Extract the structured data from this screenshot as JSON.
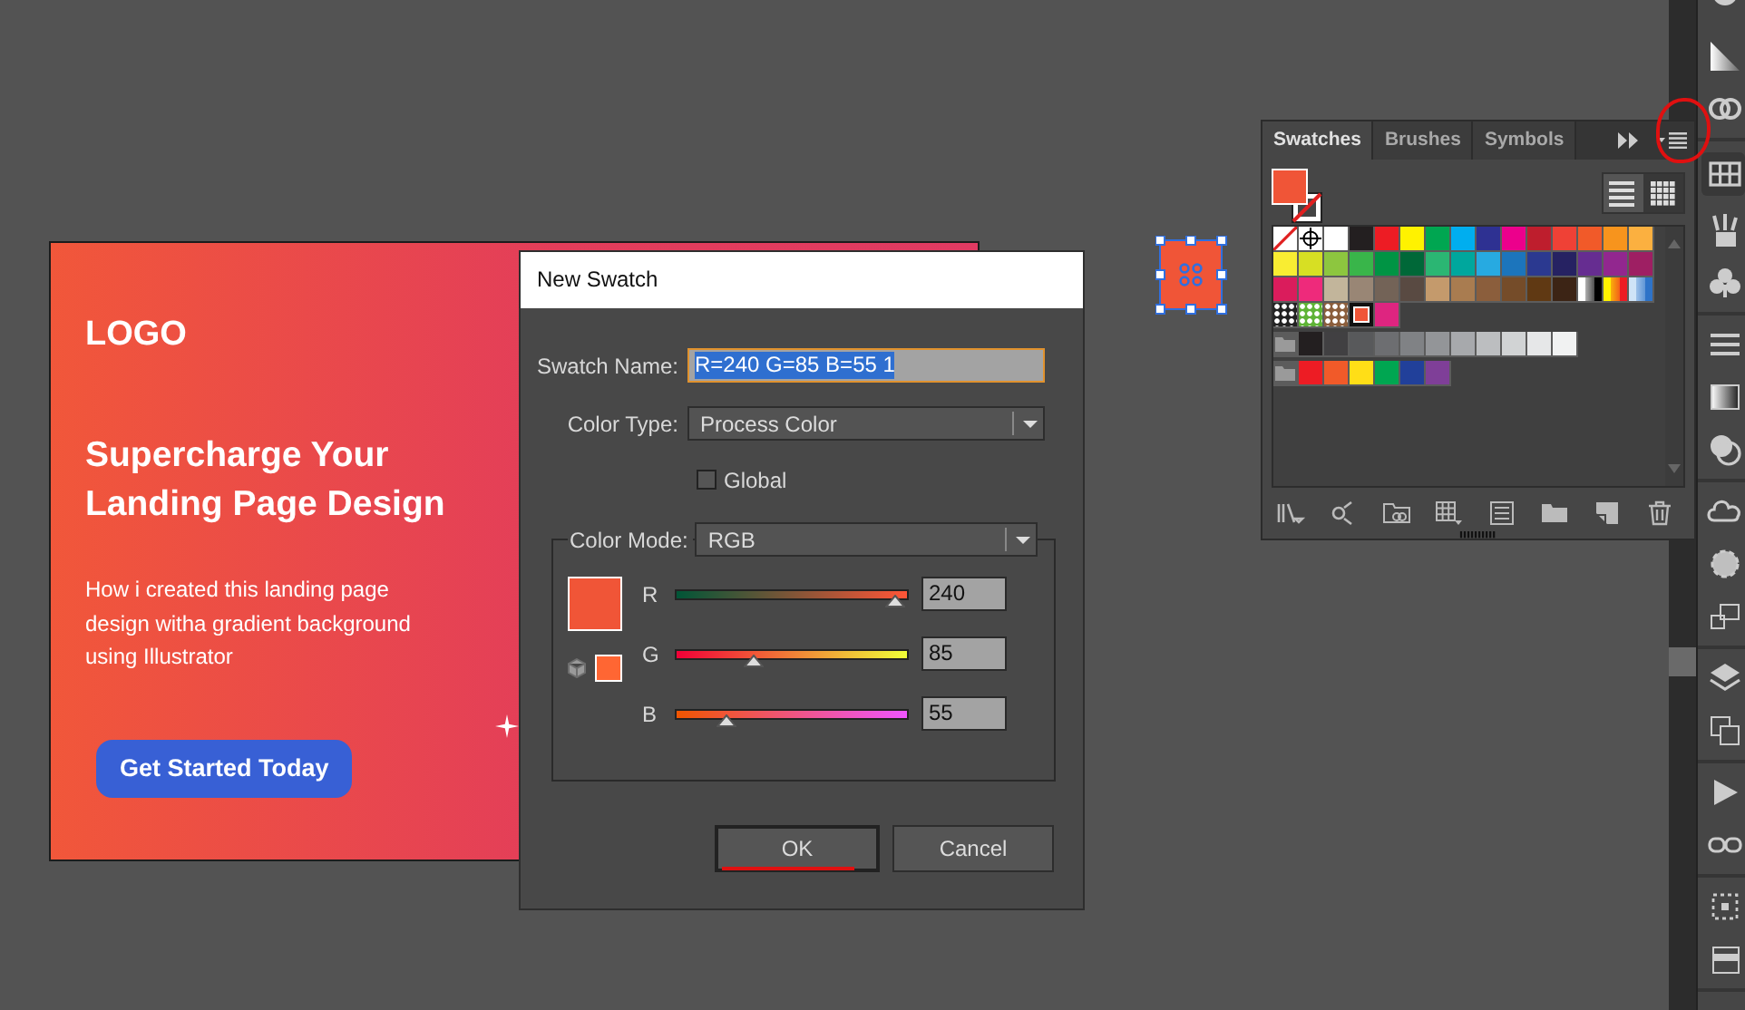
{
  "artboard": {
    "logo": "LOGO",
    "headline": "Supercharge Your Landing Page Design",
    "body": "How i created this landing page design witha gradient background using Illustrator",
    "button": "Get Started Today"
  },
  "dialog": {
    "title": "New Swatch",
    "name_field": {
      "label": "Swatch Name:",
      "value": "R=240 G=85 B=55 1",
      "text_selected": true
    },
    "color_type": {
      "label": "Color Type:",
      "value": "Process Color"
    },
    "global": {
      "label": "Global",
      "checked": false
    },
    "color_mode": {
      "label": "Color Mode:",
      "value": "RGB"
    },
    "channels": [
      {
        "name": "R",
        "level": 0.941,
        "reading": "240"
      },
      {
        "name": "G",
        "level": 0.333,
        "reading": "85"
      },
      {
        "name": "B",
        "level": 0.216,
        "reading": "55"
      }
    ],
    "buttons": [
      {
        "label": "OK",
        "default": true
      },
      {
        "label": "Cancel",
        "default": false
      }
    ]
  },
  "swatches_panel": {
    "tabs": [
      {
        "label": "Swatches",
        "selected": true
      },
      {
        "label": "Brushes",
        "selected": false
      },
      {
        "label": "Symbols",
        "selected": false
      }
    ],
    "views": [
      {
        "kind": "list",
        "selected": false
      },
      {
        "kind": "grid",
        "selected": true
      }
    ],
    "rows": [
      {
        "swatches": [
          {
            "kind": "none",
            "selected": false
          },
          {
            "kind": "registration",
            "selected": false
          },
          {
            "kind": "color",
            "color": "#ffffff",
            "selected": false
          },
          {
            "kind": "color",
            "color": "#231f20",
            "selected": false
          },
          {
            "kind": "color",
            "color": "#ed1c24",
            "selected": false
          },
          {
            "kind": "color",
            "color": "#fff200",
            "selected": false
          },
          {
            "kind": "color",
            "color": "#00a651",
            "selected": false
          },
          {
            "kind": "color",
            "color": "#00aeef",
            "selected": false
          },
          {
            "kind": "color",
            "color": "#2e3192",
            "selected": false
          },
          {
            "kind": "color",
            "color": "#ec008c",
            "selected": false
          },
          {
            "kind": "color",
            "color": "#be1e2d",
            "selected": false
          },
          {
            "kind": "color",
            "color": "#ef4136",
            "selected": false
          },
          {
            "kind": "color",
            "color": "#f15a29",
            "selected": false
          },
          {
            "kind": "color",
            "color": "#f7941d",
            "selected": false
          },
          {
            "kind": "color",
            "color": "#fbb040",
            "selected": false
          }
        ]
      },
      {
        "swatches": [
          {
            "kind": "color",
            "color": "#f9ed32",
            "selected": false
          },
          {
            "kind": "color",
            "color": "#d7df23",
            "selected": false
          },
          {
            "kind": "color",
            "color": "#8dc63f",
            "selected": false
          },
          {
            "kind": "color",
            "color": "#39b54a",
            "selected": false
          },
          {
            "kind": "color",
            "color": "#009444",
            "selected": false
          },
          {
            "kind": "color",
            "color": "#006838",
            "selected": false
          },
          {
            "kind": "color",
            "color": "#2bb673",
            "selected": false
          },
          {
            "kind": "color",
            "color": "#00a79d",
            "selected": false
          },
          {
            "kind": "color",
            "color": "#27aae1",
            "selected": false
          },
          {
            "kind": "color",
            "color": "#1c75bc",
            "selected": false
          },
          {
            "kind": "color",
            "color": "#2b3990",
            "selected": false
          },
          {
            "kind": "color",
            "color": "#262262",
            "selected": false
          },
          {
            "kind": "color",
            "color": "#662d91",
            "selected": false
          },
          {
            "kind": "color",
            "color": "#92278f",
            "selected": false
          },
          {
            "kind": "color",
            "color": "#9e1f63",
            "selected": false
          }
        ]
      },
      {
        "swatches": [
          {
            "kind": "color",
            "color": "#da1c5c",
            "selected": false
          },
          {
            "kind": "color",
            "color": "#ee2a7b",
            "selected": false
          },
          {
            "kind": "color",
            "color": "#c2b59b",
            "selected": false
          },
          {
            "kind": "color",
            "color": "#998675",
            "selected": false
          },
          {
            "kind": "color",
            "color": "#736357",
            "selected": false
          },
          {
            "kind": "color",
            "color": "#594a42",
            "selected": false
          },
          {
            "kind": "color",
            "color": "#c49a6c",
            "selected": false
          },
          {
            "kind": "color",
            "color": "#a97c50",
            "selected": false
          },
          {
            "kind": "color",
            "color": "#8b5e3c",
            "selected": false
          },
          {
            "kind": "color",
            "color": "#754c29",
            "selected": false
          },
          {
            "kind": "color",
            "color": "#603913",
            "selected": false
          },
          {
            "kind": "color",
            "color": "#3c2415",
            "selected": false
          },
          {
            "kind": "gradient",
            "stops": [
              {
                "color": "#ffffff"
              },
              {
                "color": "#000000"
              }
            ],
            "selected": false
          },
          {
            "kind": "gradient",
            "stops": [
              {
                "color": "#fff200"
              },
              {
                "color": "#ed1c24"
              }
            ],
            "selected": false
          },
          {
            "kind": "gradient",
            "stops": [
              {
                "color": "#cfe3f7"
              },
              {
                "color": "#2e73c8"
              }
            ],
            "selected": false
          }
        ]
      },
      {
        "swatches": [
          {
            "kind": "pattern",
            "color": "#222222",
            "selected": false
          },
          {
            "kind": "pattern",
            "color": "#5fb336",
            "selected": false
          },
          {
            "kind": "pattern",
            "color": "#8b5e3c",
            "selected": false
          },
          {
            "kind": "color",
            "color": "#f05537",
            "selected": true
          },
          {
            "kind": "color",
            "color": "#de2580",
            "selected": false
          }
        ]
      },
      {
        "swatches": [
          {
            "kind": "folder",
            "selected": false
          },
          {
            "kind": "color",
            "color": "#231f20",
            "selected": false
          },
          {
            "kind": "color",
            "color": "#414042",
            "selected": false
          },
          {
            "kind": "color",
            "color": "#58595b",
            "selected": false
          },
          {
            "kind": "color",
            "color": "#6d6e71",
            "selected": false
          },
          {
            "kind": "color",
            "color": "#808285",
            "selected": false
          },
          {
            "kind": "color",
            "color": "#939598",
            "selected": false
          },
          {
            "kind": "color",
            "color": "#a7a9ac",
            "selected": false
          },
          {
            "kind": "color",
            "color": "#bcbec0",
            "selected": false
          },
          {
            "kind": "color",
            "color": "#d1d3d4",
            "selected": false
          },
          {
            "kind": "color",
            "color": "#e6e7e8",
            "selected": false
          },
          {
            "kind": "color",
            "color": "#f1f2f2",
            "selected": false
          }
        ]
      },
      {
        "swatches": [
          {
            "kind": "folder",
            "selected": false
          },
          {
            "kind": "color",
            "color": "#ed1c24",
            "selected": false
          },
          {
            "kind": "color",
            "color": "#f15a29",
            "selected": false
          },
          {
            "kind": "color",
            "color": "#ffde17",
            "selected": false
          },
          {
            "kind": "color",
            "color": "#00a651",
            "selected": false
          },
          {
            "kind": "color",
            "color": "#21409a",
            "selected": false
          },
          {
            "kind": "color",
            "color": "#7f3f98",
            "selected": false
          }
        ]
      }
    ]
  }
}
